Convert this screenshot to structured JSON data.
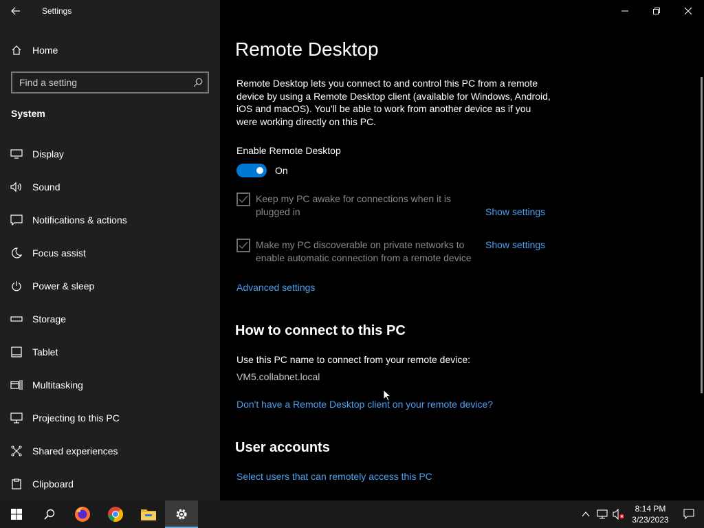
{
  "app": {
    "title": "Settings"
  },
  "sidebar": {
    "home_label": "Home",
    "search_placeholder": "Find a setting",
    "section": "System",
    "items": [
      {
        "label": "Display",
        "icon": "monitor-icon"
      },
      {
        "label": "Sound",
        "icon": "speaker-icon"
      },
      {
        "label": "Notifications & actions",
        "icon": "notification-icon"
      },
      {
        "label": "Focus assist",
        "icon": "moon-icon"
      },
      {
        "label": "Power & sleep",
        "icon": "power-icon"
      },
      {
        "label": "Storage",
        "icon": "storage-icon"
      },
      {
        "label": "Tablet",
        "icon": "tablet-icon"
      },
      {
        "label": "Multitasking",
        "icon": "multitasking-icon"
      },
      {
        "label": "Projecting to this PC",
        "icon": "projecting-icon"
      },
      {
        "label": "Shared experiences",
        "icon": "shared-icon"
      },
      {
        "label": "Clipboard",
        "icon": "clipboard-icon"
      }
    ]
  },
  "main": {
    "title": "Remote Desktop",
    "description": "Remote Desktop lets you connect to and control this PC from a remote device by using a Remote Desktop client (available for Windows, Android, iOS and macOS). You'll be able to work from another device as if you were working directly on this PC.",
    "enable_label": "Enable Remote Desktop",
    "toggle_state": "On",
    "checkbox1": {
      "label": "Keep my PC awake for connections when it is plugged in",
      "checked": true,
      "link": "Show settings"
    },
    "checkbox2": {
      "label": "Make my PC discoverable on private networks to enable automatic connection from a remote device",
      "checked": true,
      "link": "Show settings"
    },
    "advanced_link": "Advanced settings",
    "how_heading": "How to connect to this PC",
    "pc_name_label": "Use this PC name to connect from your remote device:",
    "pc_name": "VM5.collabnet.local",
    "client_link": "Don't have a Remote Desktop client on your remote device?",
    "user_heading": "User accounts",
    "users_link": "Select users that can remotely access this PC"
  },
  "taskbar": {
    "time": "8:14 PM",
    "date": "3/23/2023"
  },
  "colors": {
    "accent": "#0078d4",
    "link": "#4ca0f0",
    "sidebar_bg": "#1f1f1f",
    "main_bg": "#000000"
  }
}
